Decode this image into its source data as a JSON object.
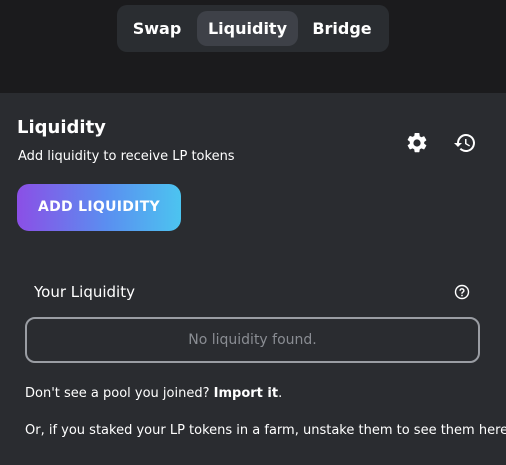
{
  "nav": {
    "tabs": [
      {
        "label": "Swap",
        "active": false
      },
      {
        "label": "Liquidity",
        "active": true
      },
      {
        "label": "Bridge",
        "active": false
      }
    ]
  },
  "panel": {
    "title": "Liquidity",
    "subtitle": "Add liquidity to receive LP tokens",
    "settings_icon": "gear-icon",
    "history_icon": "history-icon",
    "add_button_label": "ADD LIQUIDITY",
    "your_liquidity_label": "Your Liquidity",
    "help_icon": "question-circle-icon",
    "empty_message": "No liquidity found.",
    "import_prefix": "Don't see a pool you joined?",
    "import_link": "Import it",
    "import_suffix": ".",
    "unstake_note": "Or, if you staked your LP tokens in a farm, unstake them to see them here."
  },
  "colors": {
    "background": "#1b1b1d",
    "panel": "#2a2c30",
    "tab_active": "#3e4148",
    "button_gradient_start": "#8b4fe6",
    "button_gradient_end": "#4cc4f0"
  }
}
